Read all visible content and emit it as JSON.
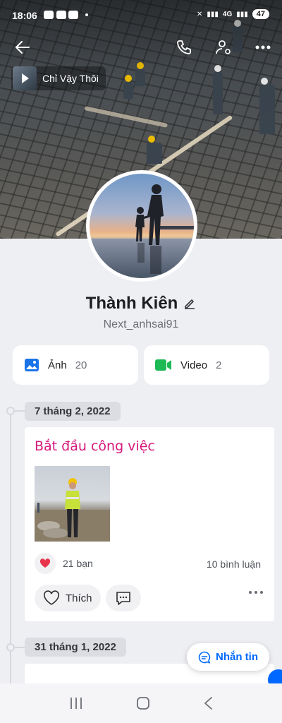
{
  "status_bar": {
    "time": "18:06",
    "network": "4G",
    "battery": "47"
  },
  "music": {
    "title": "Chỉ Vậy Thôi"
  },
  "profile": {
    "name": "Thành Kiên",
    "username": "Next_anhsai91"
  },
  "tiles": [
    {
      "label": "Ảnh",
      "count": "20",
      "icon": "image-icon",
      "color": "#1a73e8"
    },
    {
      "label": "Video",
      "count": "2",
      "icon": "video-icon",
      "color": "#1db954"
    }
  ],
  "timeline": [
    {
      "date": "7 tháng 2, 2022",
      "post": {
        "title": "Bắt đầu công việc",
        "reaction_count": "21 bạn",
        "comment_count": "10 bình luận",
        "like_label": "Thích"
      }
    },
    {
      "date": "31 tháng 1, 2022"
    }
  ],
  "actions": {
    "message_label": "Nhắn tin"
  },
  "colors": {
    "accent": "#0068ff",
    "title_pink": "#d6187c",
    "heart": "#e8344a"
  }
}
